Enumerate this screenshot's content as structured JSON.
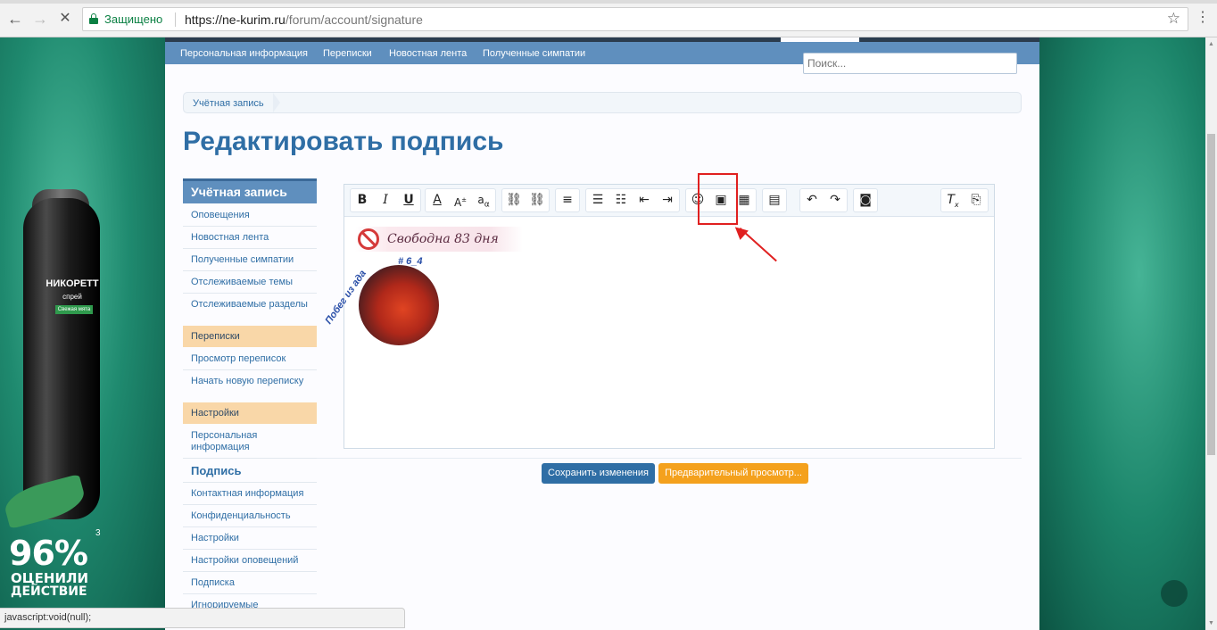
{
  "browser": {
    "secure_label": "Защищено",
    "url_host": "https://ne-kurim.ru",
    "url_path": "/forum/account/signature"
  },
  "ad": {
    "product": "НИКОРЕТТ",
    "product_sub": "спрей",
    "badge": "Свежая мята",
    "percent": "96%",
    "superscript": "3",
    "line1": "ОЦЕНИЛИ",
    "line2": "ДЕЙСТВИЕ"
  },
  "nav": {
    "items": [
      "Персональная информация",
      "Переписки",
      "Новостная лента",
      "Полученные симпатии"
    ],
    "search_placeholder": "Поиск..."
  },
  "breadcrumb": "Учётная запись",
  "page_title": "Редактировать подпись",
  "sidebar": {
    "header": "Учётная запись",
    "group1": [
      "Оповещения",
      "Новостная лента",
      "Полученные симпатии",
      "Отслеживаемые темы",
      "Отслеживаемые разделы"
    ],
    "section2": "Переписки",
    "group2": [
      "Просмотр переписок",
      "Начать новую переписку"
    ],
    "section3": "Настройки",
    "personal_line1": "Персональная",
    "personal_line2": "информация",
    "active": "Подпись",
    "group3": [
      "Контактная информация",
      "Конфиденциальность",
      "Настройки",
      "Настройки оповещений",
      "Подписка",
      "Игнорируемые"
    ]
  },
  "editor": {
    "toolbar_icons": [
      "bold-icon",
      "italic-icon",
      "underline-icon",
      "text-color-icon",
      "font-size-icon",
      "font-family-icon",
      "link-icon",
      "unlink-icon",
      "align-icon",
      "bullet-list-icon",
      "numbered-list-icon",
      "outdent-icon",
      "indent-icon",
      "smilie-icon",
      "image-icon",
      "media-icon",
      "quote-icon",
      "undo-icon",
      "redo-icon",
      "camera-icon",
      "remove-format-icon",
      "toggle-bbcode-icon"
    ],
    "signature_text": "Свободна 83 дня",
    "badge_text": "Побег из ада",
    "badge_num": "# 6_4"
  },
  "buttons": {
    "save": "Сохранить изменения",
    "preview": "Предварительный просмотр..."
  },
  "status_bar": "javascript:void(null);"
}
